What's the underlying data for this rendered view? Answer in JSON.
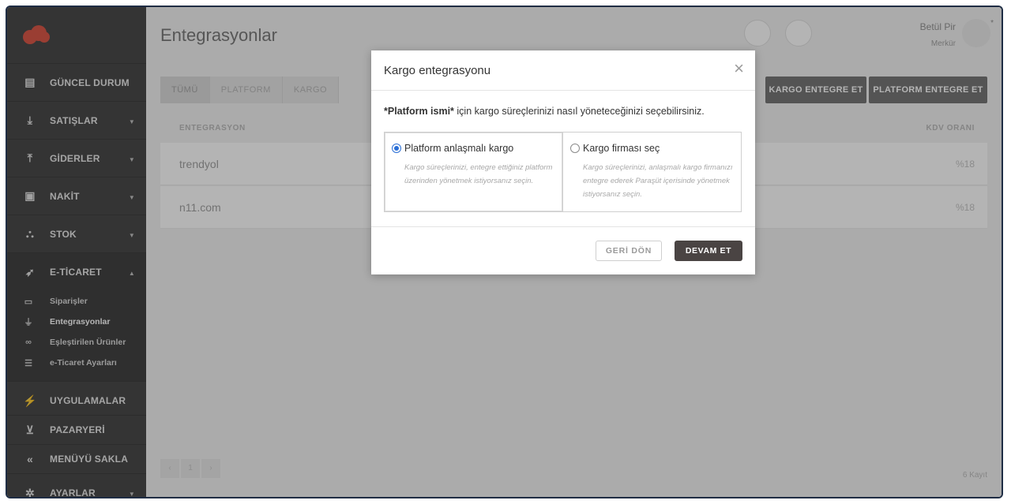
{
  "header": {
    "title": "Entegrasyonlar"
  },
  "user": {
    "name": "Betül Pir",
    "role": "Merkür",
    "star": "*"
  },
  "sidebar": {
    "items": [
      {
        "label": "GÜNCEL DURUM"
      },
      {
        "label": "SATIŞLAR"
      },
      {
        "label": "GİDERLER"
      },
      {
        "label": "NAKİT"
      },
      {
        "label": "STOK"
      },
      {
        "label": "E-TİCARET"
      }
    ],
    "eticaret_sub": [
      {
        "label": "Siparişler"
      },
      {
        "label": "Entegrasyonlar"
      },
      {
        "label": "Eşleştirilen Ürünler"
      },
      {
        "label": "e-Ticaret Ayarları"
      }
    ],
    "bottom": [
      {
        "label": "UYGULAMALAR"
      },
      {
        "label": "PAZARYERİ"
      },
      {
        "label": "MENÜYÜ SAKLA"
      },
      {
        "label": "AYARLAR"
      }
    ]
  },
  "tabs": [
    "TÜMÜ",
    "PLATFORM",
    "KARGO"
  ],
  "actions": {
    "kargo": "KARGO ENTEGRE ET",
    "platform": "PLATFORM ENTEGRE ET"
  },
  "table": {
    "col_integration": "ENTEGRASYON",
    "col_kdv": "KDV ORANI",
    "rows": [
      {
        "name": "trendyol",
        "kdv": "%18"
      },
      {
        "name": "n11.com",
        "kdv": "%18"
      }
    ]
  },
  "pagination": {
    "prev": "‹",
    "page": "1",
    "next": "›",
    "records": "6 Kayıt"
  },
  "modal": {
    "title": "Kargo entegrasyonu",
    "close": "×",
    "desc_bold": "*Platform ismi*",
    "desc_rest": " için kargo süreçlerinizi nasıl yöneteceğinizi seçebilirsiniz.",
    "options": [
      {
        "title": "Platform anlaşmalı kargo",
        "desc": "Kargo süreçlerinizi, entegre ettiğiniz platform üzerinden yönetmek istiyorsanız seçin.",
        "selected": true
      },
      {
        "title": "Kargo firması seç",
        "desc": "Kargo süreçlerinizi, anlaşmalı kargo firmanızı entegre ederek Paraşüt içerisinde yönetmek istiyorsanız seçin.",
        "selected": false
      }
    ],
    "back": "GERİ DÖN",
    "next": "DEVAM ET"
  },
  "colors": {
    "accent": "#2b6fd6",
    "sidebar": "#3b3b3b",
    "primary_button": "#4a4443",
    "logo": "#d84a3a"
  }
}
